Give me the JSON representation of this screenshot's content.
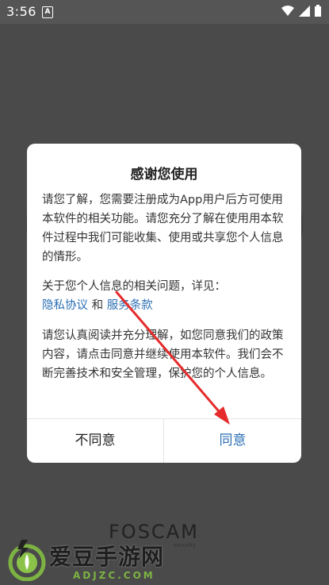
{
  "status_bar": {
    "time": "3:56",
    "notification_icon": "A",
    "icons": [
      "wifi-icon",
      "signal-icon",
      "battery-icon"
    ]
  },
  "dialog": {
    "title": "感谢您使用",
    "paragraph1": "请您了解，您需要注册成为App用户后方可使用本软件的相关功能。请您充分了解在使用用本软件过程中我们可能收集、使用或共享您个人信息的情形。",
    "paragraph2_prefix": "关于您个人信息的相关问题，详见：",
    "privacy_link": "隐私协议",
    "and_text": "和",
    "terms_link": "服务条款",
    "paragraph3": "请您认真阅读并充分理解，如您同意我们的政策内容，请点击同意并继续使用本软件。我们会不断完善技术和安全管理，保护您的个人信息。",
    "disagree_label": "不同意",
    "agree_label": "同意"
  },
  "brand": {
    "name": "FOSCAM",
    "tagline": "security"
  },
  "watermark": {
    "title": "爱豆手游网",
    "url": "ADJZC.COM"
  },
  "colors": {
    "accent": "#2c6fb5",
    "arrow": "#e52b2b",
    "overlay": "#4a4a4a"
  }
}
